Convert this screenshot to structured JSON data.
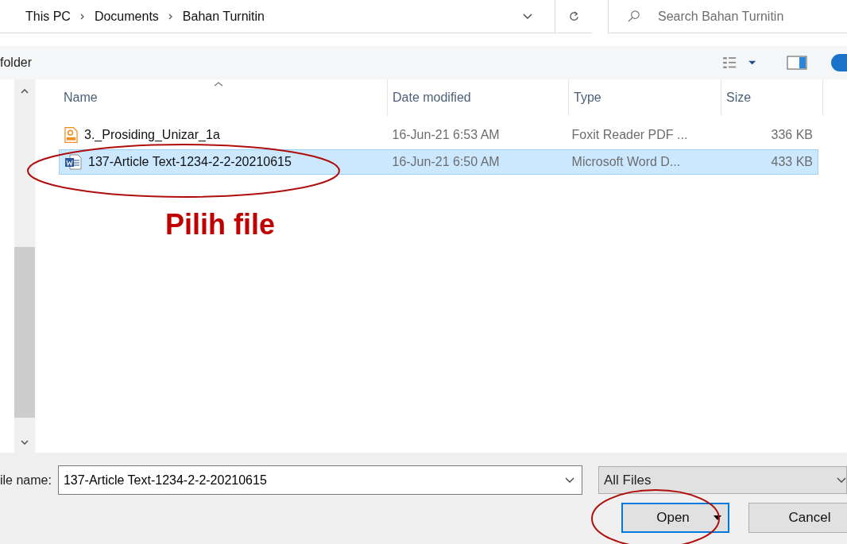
{
  "breadcrumb": [
    {
      "label": "This PC"
    },
    {
      "label": "Documents"
    },
    {
      "label": "Bahan Turnitin"
    }
  ],
  "search": {
    "placeholder": "Search Bahan Turnitin"
  },
  "toolbar": {
    "label": "folder"
  },
  "table": {
    "columns": [
      {
        "label": "Name",
        "sorted": true
      },
      {
        "label": "Date modified",
        "sorted": false
      },
      {
        "label": "Type",
        "sorted": false
      },
      {
        "label": "Size",
        "sorted": false
      }
    ],
    "rows": [
      {
        "kind": "pdf",
        "name": "3._Prosiding_Unizar_1a",
        "date": "16-Jun-21 6:53 AM",
        "type": "Foxit Reader PDF ...",
        "size": "336 KB",
        "selected": false
      },
      {
        "kind": "word",
        "name": "137-Article Text-1234-2-2-20210615",
        "date": "16-Jun-21 6:50 AM",
        "type": "Microsoft Word D...",
        "size": "433 KB",
        "selected": true
      }
    ]
  },
  "annotation": {
    "text": "Pilih file"
  },
  "file_name": {
    "label": "ile name:",
    "value": "137-Article Text-1234-2-2-20210615"
  },
  "filter": {
    "value": "All Files"
  },
  "buttons": [
    {
      "label": "Open",
      "kind": "split"
    },
    {
      "label": "Cancel",
      "kind": "plain"
    }
  ]
}
